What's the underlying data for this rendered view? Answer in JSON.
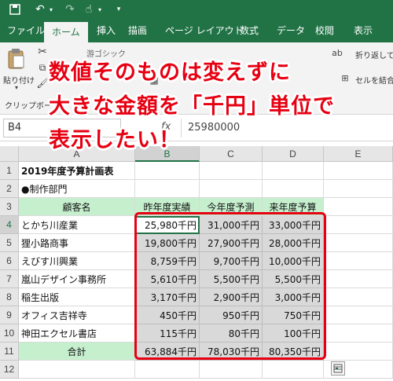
{
  "app": {
    "brand_color": "#217346",
    "qat_icons": [
      "save-icon",
      "undo-icon",
      "redo-icon",
      "touch-mode-icon",
      "customize-icon"
    ]
  },
  "tabs": [
    "ファイル",
    "ホーム",
    "挿入",
    "描画",
    "ページ レイアウト",
    "数式",
    "データ",
    "校閲",
    "表示"
  ],
  "active_tab": "ホーム",
  "ribbon": {
    "paste_label": "貼り付け",
    "clipboard_group": "クリップボード",
    "font_name": "游ゴシック",
    "wrap_text": "折り返して全",
    "merge_center": "セルを結合し"
  },
  "formula_bar": {
    "name_box": "B4",
    "fx": "fx",
    "value": "25980000"
  },
  "columns": [
    "A",
    "B",
    "C",
    "D",
    "E"
  ],
  "rows": [
    "1",
    "2",
    "3",
    "4",
    "5",
    "6",
    "7",
    "8",
    "9",
    "10",
    "11",
    "12"
  ],
  "sheet": {
    "title": "2019年度予算計画表",
    "dept": "●制作部門",
    "headers": [
      "顧客名",
      "昨年度実績",
      "今年度予測",
      "来年度予算"
    ],
    "data": [
      {
        "name": "とかち川産業",
        "b": "25,980千円",
        "c": "31,000千円",
        "d": "33,000千円"
      },
      {
        "name": "狸小路商事",
        "b": "19,800千円",
        "c": "27,900千円",
        "d": "28,000千円"
      },
      {
        "name": "えびす川興業",
        "b": "8,759千円",
        "c": "9,700千円",
        "d": "10,000千円"
      },
      {
        "name": "嵐山デザイン事務所",
        "b": "5,610千円",
        "c": "5,500千円",
        "d": "5,500千円"
      },
      {
        "name": "稲生出版",
        "b": "3,170千円",
        "c": "2,900千円",
        "d": "3,000千円"
      },
      {
        "name": "オフィス吉祥寺",
        "b": "450千円",
        "c": "950千円",
        "d": "750千円"
      },
      {
        "name": "神田エクセル書店",
        "b": "115千円",
        "c": "80千円",
        "d": "100千円"
      }
    ],
    "total": {
      "name": "合計",
      "b": "63,884千円",
      "c": "78,030千円",
      "d": "80,350千円"
    }
  },
  "overlay": {
    "line1": "数値そのものは変えずに",
    "line2": "大きな金額を「千円」単位で",
    "line3": "表示したい！",
    "color": "#e60012"
  }
}
